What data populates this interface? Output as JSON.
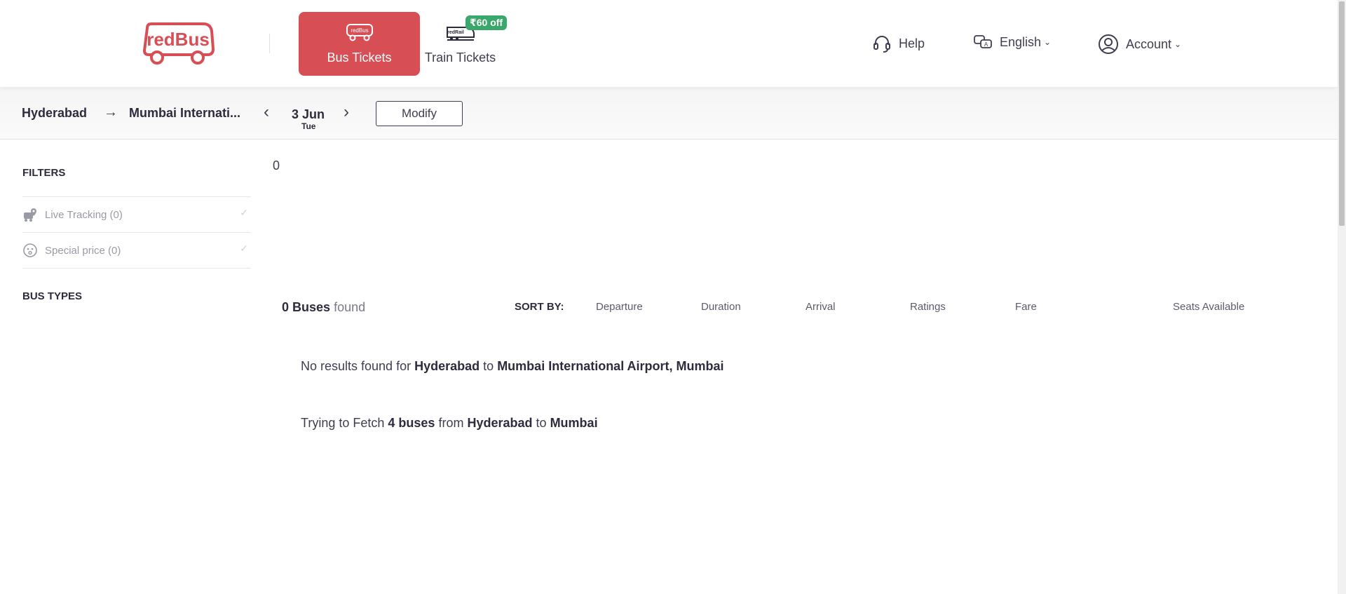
{
  "header": {
    "logo_text": "redBus",
    "tabs": [
      {
        "label": "Bus Tickets",
        "active": true,
        "icon": "bus-icon",
        "icon_text": "redBus"
      },
      {
        "label": "Train Tickets",
        "active": false,
        "icon": "train-icon",
        "icon_text": "redRail",
        "badge": "₹60 off"
      }
    ],
    "nav": {
      "help": "Help",
      "language": "English",
      "account": "Account"
    }
  },
  "search": {
    "from": "Hyderabad",
    "to": "Mumbai Internati...",
    "date": "3 Jun",
    "day": "Tue",
    "modify": "Modify"
  },
  "sidebar": {
    "filters_title": "FILTERS",
    "filters": [
      {
        "label": "Live Tracking (0)",
        "icon": "live-tracking-icon"
      },
      {
        "label": "Special price (0)",
        "icon": "special-price-icon"
      }
    ],
    "bus_types_title": "BUS TYPES"
  },
  "main": {
    "zero_text": "0",
    "results": {
      "count": "0 Buses",
      "suffix": "found"
    },
    "sort_by_label": "SORT BY:",
    "sort_options": [
      "Departure",
      "Duration",
      "Arrival",
      "Ratings",
      "Fare",
      "Seats Available"
    ],
    "no_results": {
      "prefix": "No results found for",
      "from": "Hyderabad",
      "mid": "to",
      "to": "Mumbai International Airport, Mumbai"
    },
    "fetching": {
      "prefix": "Trying to Fetch",
      "count": "4 buses",
      "mid1": "from",
      "from": "Hyderabad",
      "mid2": "to",
      "to": "Mumbai"
    }
  },
  "colors": {
    "brand_red": "#d84e55",
    "badge_green": "#3ba86b",
    "text_dark": "#2c2c3d"
  }
}
